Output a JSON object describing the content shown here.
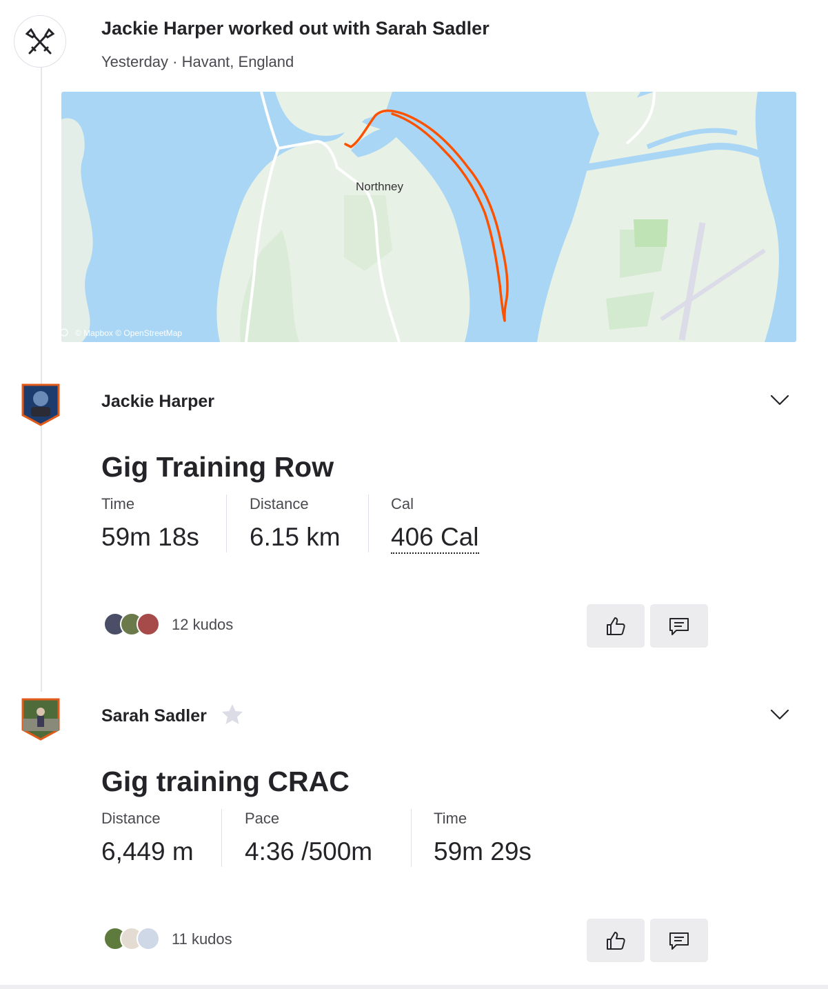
{
  "group": {
    "title": "Jackie Harper worked out with Sarah Sadler",
    "meta": "Yesterday · Havant, England",
    "icon": "crossed-oars-icon"
  },
  "map": {
    "place_label": "Northney",
    "attribution": "© Mapbox © OpenStreetMap",
    "route_color": "#fc5200",
    "water_color": "#a9d6f5",
    "land_color": "#e8f1e6"
  },
  "activities": [
    {
      "athlete": "Jackie Harper",
      "title": "Gig Training Row",
      "stats": [
        {
          "label": "Time",
          "value": "59m 18s"
        },
        {
          "label": "Distance",
          "value": "6.15 km"
        },
        {
          "label": "Cal",
          "value": "406 Cal"
        }
      ],
      "kudos": "12 kudos"
    },
    {
      "athlete": "Sarah Sadler",
      "title": "Gig training CRAC",
      "stats": [
        {
          "label": "Distance",
          "value": "6,449 m"
        },
        {
          "label": "Pace",
          "value": "4:36 /500m"
        },
        {
          "label": "Time",
          "value": "59m 29s"
        }
      ],
      "kudos": "11 kudos"
    }
  ],
  "icons": {
    "expand": "chevron-down-icon",
    "kudos": "thumbs-up-icon",
    "comment": "comment-icon",
    "subscriber": "star-icon"
  },
  "colors": {
    "accent": "#fc5200",
    "button_bg": "#ececef",
    "text": "#242428",
    "muted": "#494950"
  }
}
